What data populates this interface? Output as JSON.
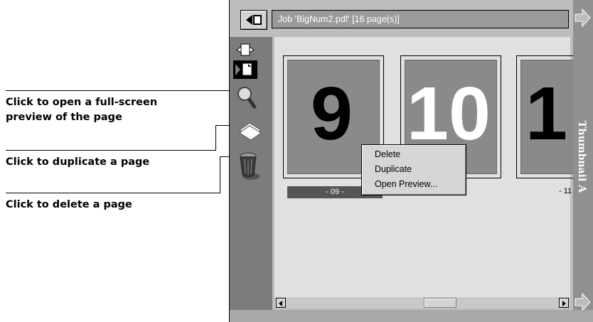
{
  "annotations": {
    "preview": "Click to open a full-screen\npreview of the page",
    "duplicate": "Click to duplicate a page",
    "delete": "Click to delete a page"
  },
  "window": {
    "title": "Job 'BigNum2.pdf' [16 page(s)]",
    "side_label": "Thumbnail A"
  },
  "thumbnails": [
    {
      "number": "9",
      "label": "- 09 -",
      "selected": true
    },
    {
      "number": "10",
      "label": "",
      "selected": false
    },
    {
      "number": "1",
      "label": "- 11",
      "selected": false
    }
  ],
  "context_menu": {
    "items": [
      "Delete",
      "Duplicate",
      "Open Preview..."
    ]
  },
  "toolbar": {
    "icons": [
      "page-orientation-icon",
      "page-icon",
      "magnifier-icon",
      "duplicate-pages-icon",
      "trash-icon"
    ]
  },
  "colors": {
    "window_bg": "#bdbdbd",
    "content_bg": "#e0e0e0",
    "thumb_bg": "#8a8a8a",
    "accent": "#555555"
  }
}
